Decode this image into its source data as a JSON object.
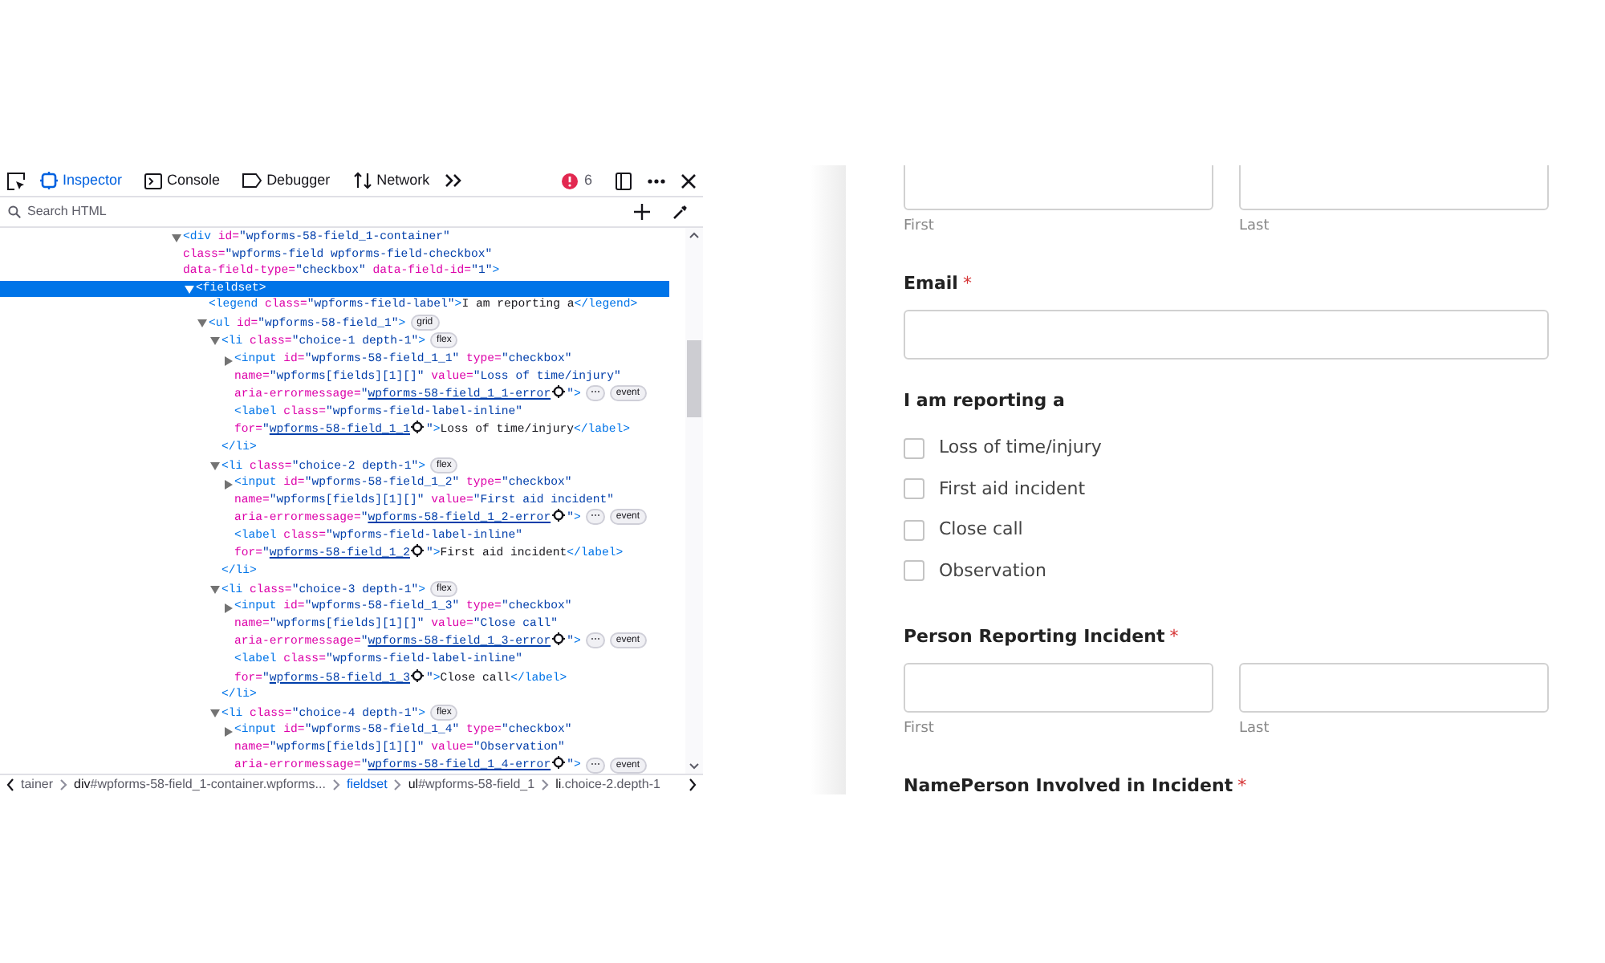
{
  "devtools": {
    "tabs": [
      {
        "label": "Inspector",
        "selected": true
      },
      {
        "label": "Console",
        "selected": false
      },
      {
        "label": "Debugger",
        "selected": false
      },
      {
        "label": "Network",
        "selected": false
      }
    ],
    "error_count": "6",
    "search": {
      "placeholder": "Search HTML"
    },
    "tree": [
      {
        "expanded": true,
        "selected": false,
        "parts": [
          {
            "kind": "tag",
            "text": "<div"
          },
          {
            "kind": "attr",
            "text": "id="
          },
          {
            "kind": "value",
            "text": "\"wpforms-58-field_1-container\""
          },
          {
            "kind": "attr",
            "text": "class="
          },
          {
            "kind": "value",
            "text": "\"wpforms-field wpforms-field-checkbox\""
          },
          {
            "kind": "attr",
            "text": "data-field-type="
          },
          {
            "kind": "value",
            "text": "\"checkbox\""
          },
          {
            "kind": "attr",
            "text": "data-field-id="
          },
          {
            "kind": "value",
            "text": "\"1\""
          },
          {
            "kind": "tag",
            "text": ">"
          }
        ],
        "children": [
          {
            "expanded": true,
            "selected": true,
            "parts": [
              {
                "kind": "tag",
                "text": "<fieldset>"
              }
            ],
            "children": [
              {
                "selected": false,
                "parts": [
                  {
                    "kind": "tag",
                    "text": "<legend"
                  },
                  {
                    "kind": "attr",
                    "text": "class="
                  },
                  {
                    "kind": "value",
                    "text": "\"wpforms-field-label\""
                  },
                  {
                    "kind": "tag",
                    "text": ">"
                  },
                  {
                    "kind": "text",
                    "text": "I am reporting a"
                  },
                  {
                    "kind": "tag",
                    "text": "</legend>"
                  }
                ]
              },
              {
                "expanded": true,
                "selected": false,
                "parts": [
                  {
                    "kind": "tag",
                    "text": "<ul"
                  },
                  {
                    "kind": "attr",
                    "text": "id="
                  },
                  {
                    "kind": "value",
                    "text": "\"wpforms-58-field_1\""
                  },
                  {
                    "kind": "tag",
                    "text": ">"
                  },
                  {
                    "kind": "layout",
                    "text": "grid"
                  }
                ],
                "children": [
                  {
                    "expanded": true,
                    "selected": false,
                    "parts": [
                      {
                        "kind": "tag",
                        "text": "<li"
                      },
                      {
                        "kind": "attr",
                        "text": "class="
                      },
                      {
                        "kind": "value",
                        "text": "\"choice-1 depth-1\""
                      },
                      {
                        "kind": "tag",
                        "text": ">"
                      },
                      {
                        "kind": "layout",
                        "text": "flex"
                      }
                    ],
                    "closing": [
                      {
                        "kind": "tag",
                        "text": "</li>"
                      }
                    ],
                    "children": [
                      {
                        "expanded": false,
                        "selected": false,
                        "parts": [
                          {
                            "kind": "tag",
                            "text": "<input"
                          },
                          {
                            "kind": "attr",
                            "text": "id="
                          },
                          {
                            "kind": "value",
                            "text": "\"wpforms-58-field_1_1\""
                          },
                          {
                            "kind": "attr",
                            "text": "type="
                          },
                          {
                            "kind": "value",
                            "text": "\"checkbox\""
                          },
                          {
                            "kind": "attr",
                            "text": "name="
                          },
                          {
                            "kind": "value",
                            "text": "\"wpforms[fields][1][]\""
                          },
                          {
                            "kind": "attr",
                            "text": "value="
                          },
                          {
                            "kind": "value",
                            "text": "\"Loss of time/injury\""
                          },
                          {
                            "kind": "attr",
                            "text": "aria-errormessage="
                          },
                          {
                            "kind": "value",
                            "text": "\""
                          },
                          {
                            "kind": "link",
                            "text": "wpforms-58-field_1_1-error"
                          },
                          {
                            "kind": "target"
                          },
                          {
                            "kind": "value",
                            "text": "\""
                          },
                          {
                            "kind": "tag",
                            "text": ">"
                          },
                          {
                            "kind": "more",
                            "text": "⋯"
                          },
                          {
                            "kind": "event",
                            "text": "event"
                          }
                        ]
                      },
                      {
                        "selected": false,
                        "parts": [
                          {
                            "kind": "tag",
                            "text": "<label"
                          },
                          {
                            "kind": "attr",
                            "text": "class="
                          },
                          {
                            "kind": "value",
                            "text": "\"wpforms-field-label-inline\""
                          },
                          {
                            "kind": "attr",
                            "text": "for="
                          },
                          {
                            "kind": "value",
                            "text": "\""
                          },
                          {
                            "kind": "link",
                            "text": "wpforms-58-field_1_1"
                          },
                          {
                            "kind": "target"
                          },
                          {
                            "kind": "value",
                            "text": "\""
                          },
                          {
                            "kind": "tag",
                            "text": ">"
                          },
                          {
                            "kind": "text",
                            "text": "Loss of time/injury"
                          },
                          {
                            "kind": "tag",
                            "text": "</label>"
                          }
                        ]
                      }
                    ]
                  },
                  {
                    "expanded": true,
                    "selected": false,
                    "parts": [
                      {
                        "kind": "tag",
                        "text": "<li"
                      },
                      {
                        "kind": "attr",
                        "text": "class="
                      },
                      {
                        "kind": "value",
                        "text": "\"choice-2 depth-1\""
                      },
                      {
                        "kind": "tag",
                        "text": ">"
                      },
                      {
                        "kind": "layout",
                        "text": "flex"
                      }
                    ],
                    "closing": [
                      {
                        "kind": "tag",
                        "text": "</li>"
                      }
                    ],
                    "children": [
                      {
                        "expanded": false,
                        "selected": false,
                        "parts": [
                          {
                            "kind": "tag",
                            "text": "<input"
                          },
                          {
                            "kind": "attr",
                            "text": "id="
                          },
                          {
                            "kind": "value",
                            "text": "\"wpforms-58-field_1_2\""
                          },
                          {
                            "kind": "attr",
                            "text": "type="
                          },
                          {
                            "kind": "value",
                            "text": "\"checkbox\""
                          },
                          {
                            "kind": "attr",
                            "text": "name="
                          },
                          {
                            "kind": "value",
                            "text": "\"wpforms[fields][1][]\""
                          },
                          {
                            "kind": "attr",
                            "text": "value="
                          },
                          {
                            "kind": "value",
                            "text": "\"First aid incident\""
                          },
                          {
                            "kind": "attr",
                            "text": "aria-errormessage="
                          },
                          {
                            "kind": "value",
                            "text": "\""
                          },
                          {
                            "kind": "link",
                            "text": "wpforms-58-field_1_2-error"
                          },
                          {
                            "kind": "target"
                          },
                          {
                            "kind": "value",
                            "text": "\""
                          },
                          {
                            "kind": "tag",
                            "text": ">"
                          },
                          {
                            "kind": "more",
                            "text": "⋯"
                          },
                          {
                            "kind": "event",
                            "text": "event"
                          }
                        ]
                      },
                      {
                        "selected": false,
                        "parts": [
                          {
                            "kind": "tag",
                            "text": "<label"
                          },
                          {
                            "kind": "attr",
                            "text": "class="
                          },
                          {
                            "kind": "value",
                            "text": "\"wpforms-field-label-inline\""
                          },
                          {
                            "kind": "attr",
                            "text": "for="
                          },
                          {
                            "kind": "value",
                            "text": "\""
                          },
                          {
                            "kind": "link",
                            "text": "wpforms-58-field_1_2"
                          },
                          {
                            "kind": "target"
                          },
                          {
                            "kind": "value",
                            "text": "\""
                          },
                          {
                            "kind": "tag",
                            "text": ">"
                          },
                          {
                            "kind": "text",
                            "text": "First aid incident"
                          },
                          {
                            "kind": "tag",
                            "text": "</label>"
                          }
                        ]
                      }
                    ]
                  },
                  {
                    "expanded": true,
                    "selected": false,
                    "parts": [
                      {
                        "kind": "tag",
                        "text": "<li"
                      },
                      {
                        "kind": "attr",
                        "text": "class="
                      },
                      {
                        "kind": "value",
                        "text": "\"choice-3 depth-1\""
                      },
                      {
                        "kind": "tag",
                        "text": ">"
                      },
                      {
                        "kind": "layout",
                        "text": "flex"
                      }
                    ],
                    "closing": [
                      {
                        "kind": "tag",
                        "text": "</li>"
                      }
                    ],
                    "children": [
                      {
                        "expanded": false,
                        "selected": false,
                        "parts": [
                          {
                            "kind": "tag",
                            "text": "<input"
                          },
                          {
                            "kind": "attr",
                            "text": "id="
                          },
                          {
                            "kind": "value",
                            "text": "\"wpforms-58-field_1_3\""
                          },
                          {
                            "kind": "attr",
                            "text": "type="
                          },
                          {
                            "kind": "value",
                            "text": "\"checkbox\""
                          },
                          {
                            "kind": "attr",
                            "text": "name="
                          },
                          {
                            "kind": "value",
                            "text": "\"wpforms[fields][1][]\""
                          },
                          {
                            "kind": "attr",
                            "text": "value="
                          },
                          {
                            "kind": "value",
                            "text": "\"Close call\""
                          },
                          {
                            "kind": "attr",
                            "text": "aria-errormessage="
                          },
                          {
                            "kind": "value",
                            "text": "\""
                          },
                          {
                            "kind": "link",
                            "text": "wpforms-58-field_1_3-error"
                          },
                          {
                            "kind": "target"
                          },
                          {
                            "kind": "value",
                            "text": "\""
                          },
                          {
                            "kind": "tag",
                            "text": ">"
                          },
                          {
                            "kind": "more",
                            "text": "⋯"
                          },
                          {
                            "kind": "event",
                            "text": "event"
                          }
                        ]
                      },
                      {
                        "selected": false,
                        "parts": [
                          {
                            "kind": "tag",
                            "text": "<label"
                          },
                          {
                            "kind": "attr",
                            "text": "class="
                          },
                          {
                            "kind": "value",
                            "text": "\"wpforms-field-label-inline\""
                          },
                          {
                            "kind": "attr",
                            "text": "for="
                          },
                          {
                            "kind": "value",
                            "text": "\""
                          },
                          {
                            "kind": "link",
                            "text": "wpforms-58-field_1_3"
                          },
                          {
                            "kind": "target"
                          },
                          {
                            "kind": "value",
                            "text": "\""
                          },
                          {
                            "kind": "tag",
                            "text": ">"
                          },
                          {
                            "kind": "text",
                            "text": "Close call"
                          },
                          {
                            "kind": "tag",
                            "text": "</label>"
                          }
                        ]
                      }
                    ]
                  },
                  {
                    "expanded": true,
                    "selected": false,
                    "parts": [
                      {
                        "kind": "tag",
                        "text": "<li"
                      },
                      {
                        "kind": "attr",
                        "text": "class="
                      },
                      {
                        "kind": "value",
                        "text": "\"choice-4 depth-1\""
                      },
                      {
                        "kind": "tag",
                        "text": ">"
                      },
                      {
                        "kind": "layout",
                        "text": "flex"
                      }
                    ],
                    "children": [
                      {
                        "expanded": false,
                        "selected": false,
                        "parts": [
                          {
                            "kind": "tag",
                            "text": "<input"
                          },
                          {
                            "kind": "attr",
                            "text": "id="
                          },
                          {
                            "kind": "value",
                            "text": "\"wpforms-58-field_1_4\""
                          },
                          {
                            "kind": "attr",
                            "text": "type="
                          },
                          {
                            "kind": "value",
                            "text": "\"checkbox\""
                          },
                          {
                            "kind": "attr",
                            "text": "name="
                          },
                          {
                            "kind": "value",
                            "text": "\"wpforms[fields][1][]\""
                          },
                          {
                            "kind": "attr",
                            "text": "value="
                          },
                          {
                            "kind": "value",
                            "text": "\"Observation\""
                          },
                          {
                            "kind": "attr",
                            "text": "aria-errormessage="
                          },
                          {
                            "kind": "value",
                            "text": "\""
                          },
                          {
                            "kind": "link",
                            "text": "wpforms-58-field_1_4-error"
                          },
                          {
                            "kind": "target"
                          },
                          {
                            "kind": "value",
                            "text": "\""
                          },
                          {
                            "kind": "tag",
                            "text": ">"
                          },
                          {
                            "kind": "more",
                            "text": "⋯"
                          },
                          {
                            "kind": "event",
                            "text": "event"
                          }
                        ]
                      }
                    ]
                  }
                ]
              }
            ]
          }
        ]
      }
    ],
    "breadcrumbs": [
      {
        "rest": "tainer",
        "selected": false
      },
      {
        "tag": "div",
        "rest": "#wpforms-58-field_1-container.wpforms...",
        "selected": false
      },
      {
        "tag": "fieldset",
        "selected": true
      },
      {
        "tag": "ul",
        "rest": "#wpforms-58-field_1",
        "selected": false
      },
      {
        "tag": "li",
        "rest": ".choice-2.depth-1",
        "selected": false
      }
    ]
  },
  "form": {
    "sections": [
      {
        "kind": "name",
        "sublabels": [
          "First",
          "Last"
        ]
      },
      {
        "kind": "single",
        "label": "Email",
        "required_mark": "*"
      },
      {
        "kind": "checkboxes",
        "label": "I am reporting a",
        "options": [
          {
            "label": "Loss of time/injury",
            "checked": false
          },
          {
            "label": "First aid incident",
            "checked": false
          },
          {
            "label": "Close call",
            "checked": false
          },
          {
            "label": "Observation",
            "checked": false
          }
        ]
      },
      {
        "kind": "name",
        "label": "Person Reporting Incident",
        "required_mark": "*",
        "sublabels": [
          "First",
          "Last"
        ]
      },
      {
        "kind": "name",
        "label": "NamePerson Involved in Incident",
        "required_mark": "*"
      }
    ]
  }
}
